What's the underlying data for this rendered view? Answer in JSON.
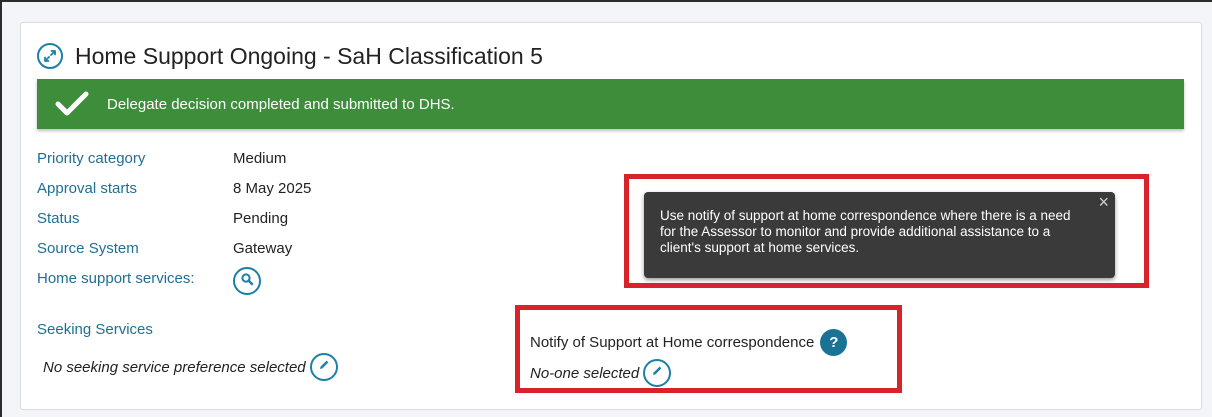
{
  "panel": {
    "title": "Home Support Ongoing - SaH Classification 5"
  },
  "banner": {
    "message": "Delegate decision completed and submitted to DHS."
  },
  "details": [
    {
      "label": "Priority category",
      "value": "Medium"
    },
    {
      "label": "Approval starts",
      "value": "8 May 2025"
    },
    {
      "label": "Status",
      "value": "Pending"
    },
    {
      "label": "Source System",
      "value": "Gateway"
    }
  ],
  "home_support": {
    "label": "Home support services:"
  },
  "seeking": {
    "label": "Seeking Services",
    "value": "No seeking service preference selected"
  },
  "notify": {
    "label": "Notify of Support at Home correspondence",
    "help_glyph": "?",
    "value": "No-one selected"
  },
  "tooltip": {
    "text": "Use notify of support at home correspondence where there is a need for the Assessor to monitor and provide additional assistance to a client's support at home services.",
    "close_glyph": "×"
  },
  "colors": {
    "banner_green": "#3d8d3b",
    "link_blue": "#1f6f94",
    "highlight_red": "#d8232a",
    "tooltip_bg": "#3a3a3a"
  },
  "icons": {
    "title": "collapse-arrows-icon",
    "banner": "checkmark-icon",
    "home_support": "magnifier-icon",
    "edit": "pencil-icon",
    "help": "question-icon",
    "close": "close-icon"
  }
}
